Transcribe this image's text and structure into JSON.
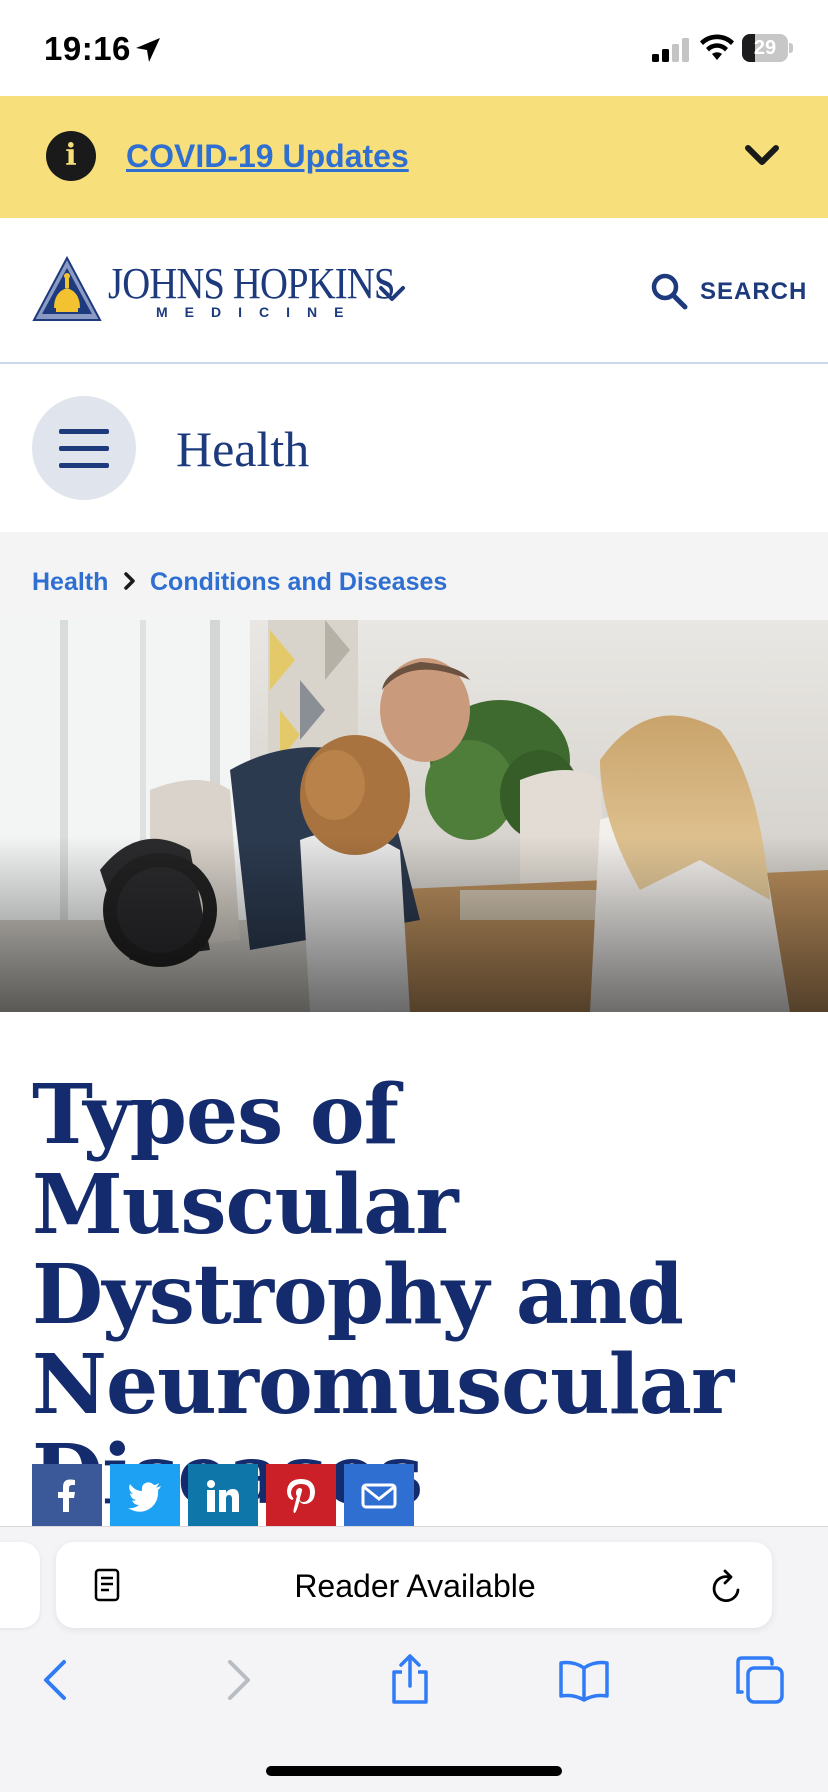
{
  "status_bar": {
    "time": "19:16",
    "battery_percent": "29",
    "icons": [
      "location-arrow-icon",
      "cellular-signal-icon",
      "wifi-icon",
      "battery-icon"
    ]
  },
  "alert_banner": {
    "icon": "info-icon",
    "info_glyph": "i",
    "link_text": "COVID-19 Updates",
    "expand_icon": "chevron-down-icon",
    "background_color": "#f7e07b"
  },
  "header": {
    "logo_name": "JOHNS HOPKINS",
    "logo_subtitle": "MEDICINE",
    "logo_menu_icon": "chevron-down-icon",
    "search_label": "SEARCH",
    "search_icon": "search-icon"
  },
  "section_nav": {
    "menu_icon": "hamburger-icon",
    "title": "Health"
  },
  "breadcrumb": {
    "items": [
      "Health",
      "Conditions and Diseases"
    ],
    "separator_icon": "chevron-right-icon"
  },
  "hero": {
    "image": "family doing a jigsaw puzzle at a table; child in wheelchair"
  },
  "article": {
    "title": "Types of Muscular Dystrophy and Neuromuscular Diseases"
  },
  "share_buttons": [
    {
      "name": "facebook",
      "icon": "facebook-icon",
      "color": "#3b5998"
    },
    {
      "name": "twitter",
      "icon": "twitter-icon",
      "color": "#1da1f2"
    },
    {
      "name": "linkedin",
      "icon": "linkedin-icon",
      "color": "#0e76a8"
    },
    {
      "name": "pinterest",
      "icon": "pinterest-icon",
      "color": "#cb2027"
    },
    {
      "name": "email",
      "icon": "email-icon",
      "color": "#2f6fd1"
    }
  ],
  "browser": {
    "reader_label": "Reader Available",
    "reader_icon": "reader-icon",
    "reload_icon": "reload-icon",
    "toolbar": [
      "back-icon",
      "forward-icon",
      "share-icon",
      "bookmarks-icon",
      "tabs-icon"
    ]
  },
  "colors": {
    "brand_navy": "#1d3a7d",
    "link_blue": "#2f6fd1",
    "title_navy": "#142c6e"
  }
}
